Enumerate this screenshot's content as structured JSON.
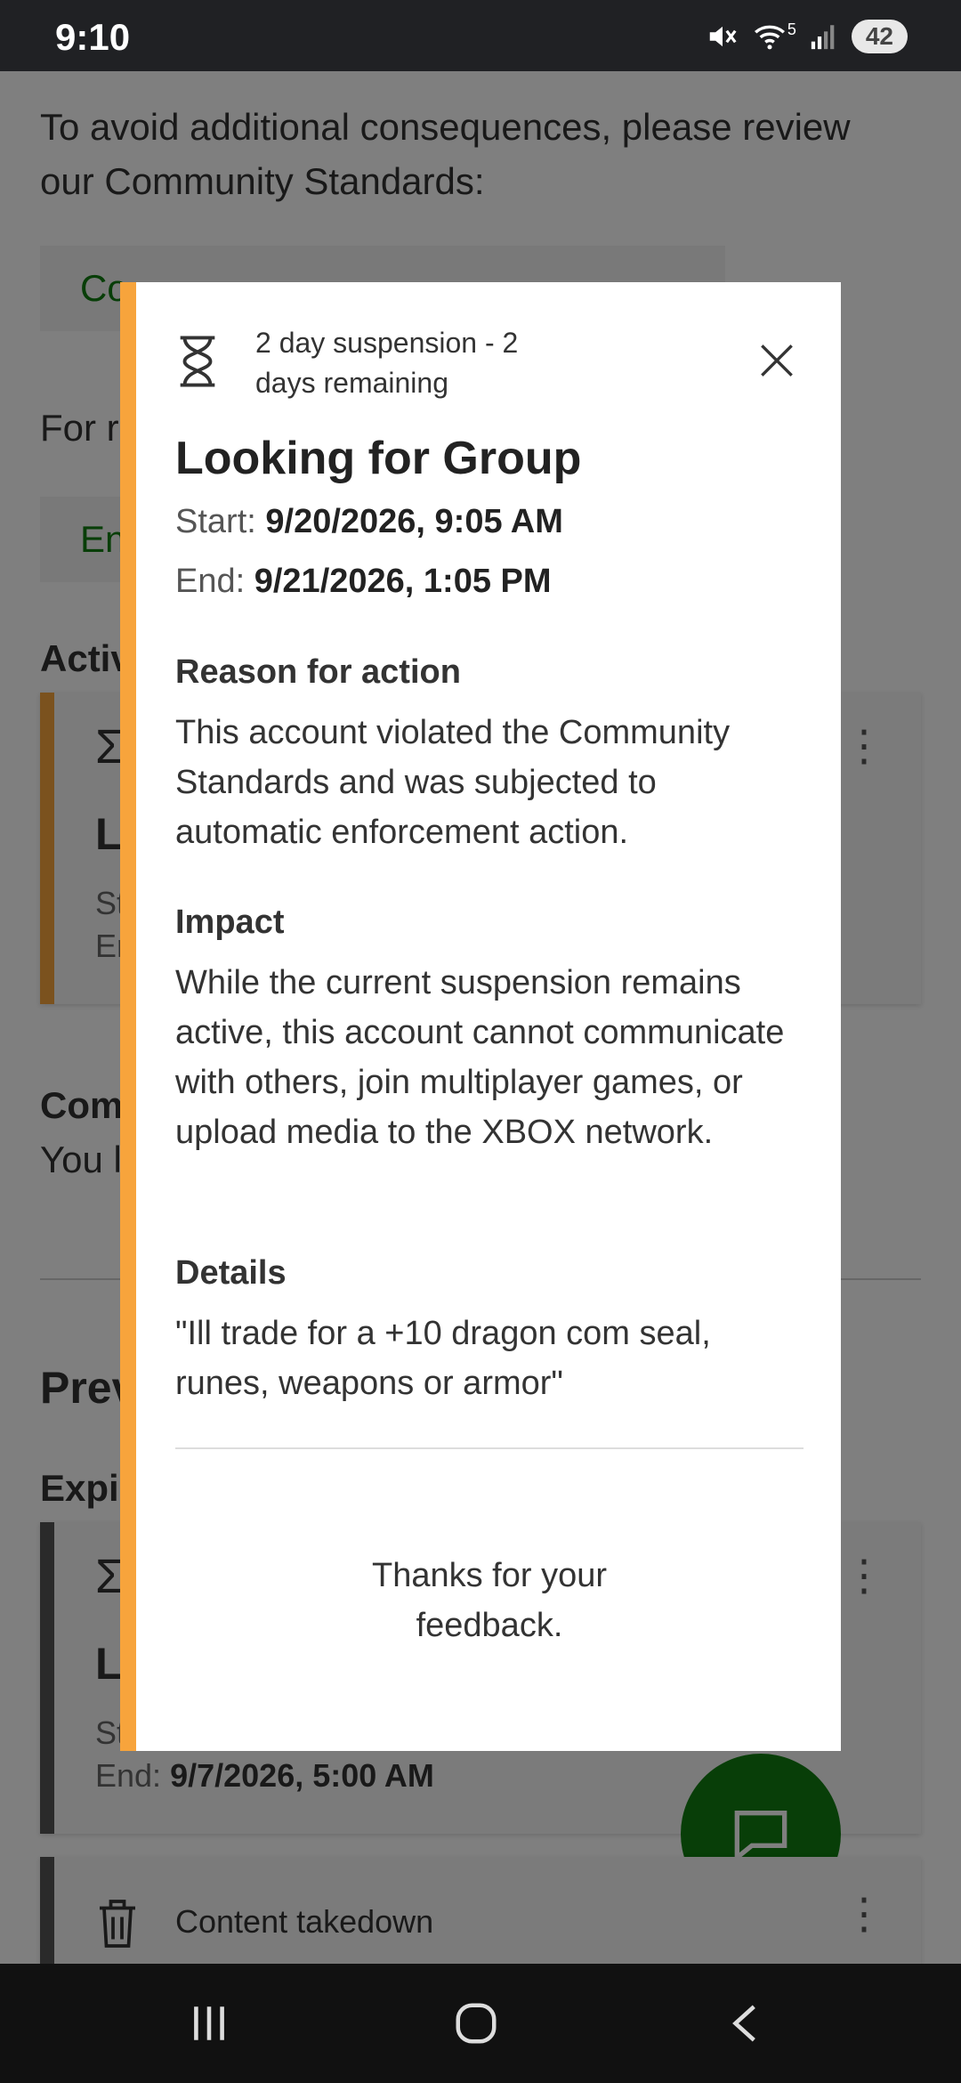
{
  "status_bar": {
    "time": "9:10",
    "battery": "42",
    "wifi_badge": "5"
  },
  "background": {
    "intro_line1": "To avoid additional consequences, please review",
    "intro_line2": "our Community Standards:",
    "standards_link": "Co",
    "for_more_prefix": "For r",
    "enforcement_link": "En",
    "active_heading": "Activ",
    "active_card": {
      "title_fragment": "L",
      "start_fragment": "St",
      "end_fragment": "Er"
    },
    "comm_heading": "Com",
    "comm_text": "You l",
    "previous_heading": "Prev",
    "expired_heading": "Expir",
    "expired_card": {
      "title_fragment": "L",
      "start_fragment": "St",
      "end_label": "End:",
      "end_value": "9/7/2026, 5:00 AM"
    },
    "takedown_card": {
      "label": "Content takedown"
    },
    "active_color": "#f7a43c",
    "expired_color": "#555555"
  },
  "dialog": {
    "chip_text": "2 day suspension - 2 days remaining",
    "title": "Looking for Group",
    "start_label": "Start:",
    "start_value": "9/20/2026, 9:05 AM",
    "end_label": "End:",
    "end_value": "9/21/2026, 1:05 PM",
    "reason_heading": "Reason for action",
    "reason_text": "This account violated the Community Standards and was subjected to automatic enforcement action.",
    "impact_heading": "Impact",
    "impact_text": "While the current suspension remains active, this account cannot communicate with others, join multiplayer games, or upload media to the XBOX network.",
    "details_heading": "Details",
    "details_text": "\"Ill trade for a +10 dragon com seal, runes, weapons or armor\"",
    "thanks_line1": "Thanks for your",
    "thanks_line2": "feedback.",
    "accent_color": "#f7a43c"
  },
  "icons": {
    "hourglass": "hourglass-icon",
    "close": "close-icon",
    "kebab": "more-options-icon",
    "trash": "trash-icon",
    "chat": "chat-icon"
  },
  "nav": {
    "recents": "recents-icon",
    "home": "home-icon",
    "back": "back-icon"
  }
}
